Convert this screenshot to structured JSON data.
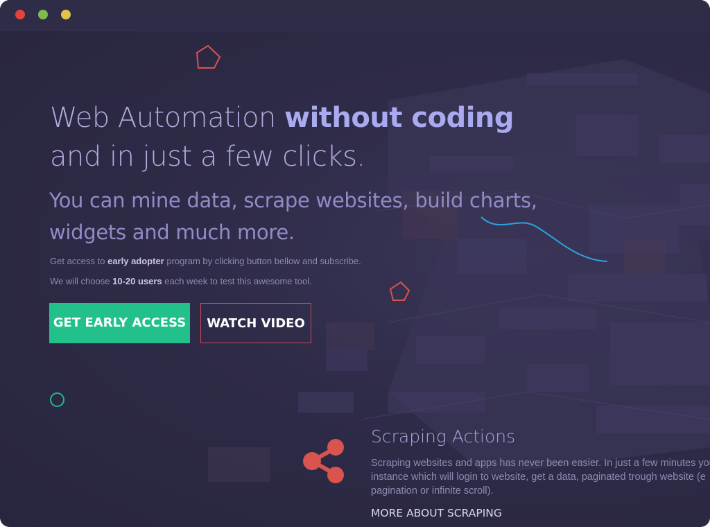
{
  "window": {
    "controls": [
      "close",
      "minimize",
      "maximize"
    ]
  },
  "hero": {
    "title_prefix": "Web Automation ",
    "title_emphasis": "without coding",
    "title_line2": "and in just a few clicks.",
    "subtitle_line1": "You can mine data, scrape websites, build charts,",
    "subtitle_line2": "widgets and much more."
  },
  "notes": {
    "line1_prefix": "Get access to ",
    "line1_bold": "early adopter",
    "line1_suffix": " program by clicking button bellow and subscribe.",
    "line2_prefix": "We will choose ",
    "line2_bold": "10-20 users",
    "line2_suffix": " each week to test this awesome tool."
  },
  "buttons": {
    "primary_label": "GET EARLY ACCESS",
    "secondary_label": "WATCH VIDEO"
  },
  "feature": {
    "icon": "share-icon",
    "title": "Scraping Actions",
    "text_line1": "Scraping websites and apps has never been easier. In just a few minutes you",
    "text_line2": "instance which will login to website, get a data, paginated trough website (e",
    "text_line3": "pagination or infinite scroll).",
    "link_label": "MORE ABOUT SCRAPING"
  },
  "colors": {
    "background": "#2b2843",
    "accent_green": "#22c08a",
    "accent_red": "#d9534f",
    "accent_blue": "#2aa4e0",
    "title_purple": "#a9aaf0"
  }
}
